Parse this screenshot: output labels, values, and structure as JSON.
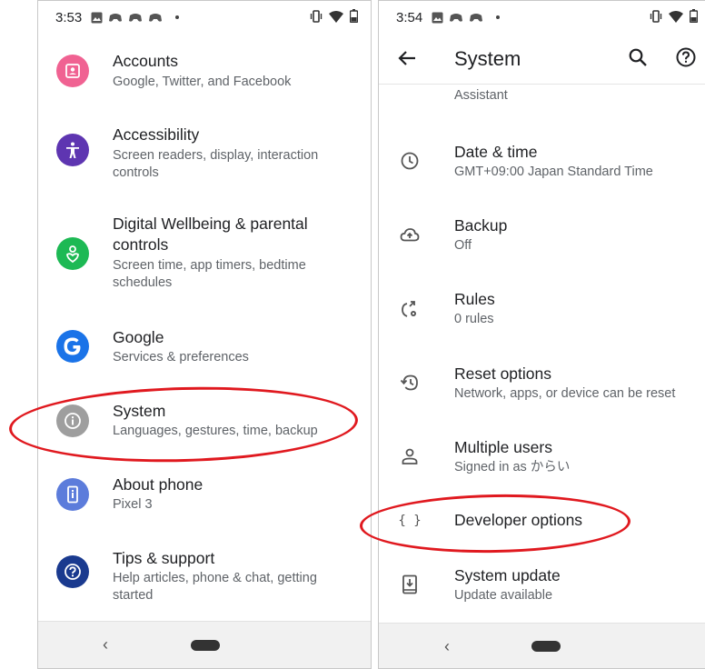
{
  "left_screen": {
    "status": {
      "time": "3:53"
    },
    "items": [
      {
        "title": "Accounts",
        "subtitle": "Google, Twitter, and Facebook",
        "icon": "accounts-icon",
        "color": "#f06292"
      },
      {
        "title": "Accessibility",
        "subtitle": "Screen readers, display, interaction controls",
        "icon": "accessibility-icon",
        "color": "#5e35b1"
      },
      {
        "title": "Digital Wellbeing & parental controls",
        "subtitle": "Screen time, app timers, bedtime schedules",
        "icon": "wellbeing-icon",
        "color": "#1db954"
      },
      {
        "title": "Google",
        "subtitle": "Services & preferences",
        "icon": "google-icon",
        "color": "#1a73e8"
      },
      {
        "title": "System",
        "subtitle": "Languages, gestures, time, backup",
        "icon": "info-icon",
        "color": "#9e9e9e"
      },
      {
        "title": "About phone",
        "subtitle": "Pixel 3",
        "icon": "phone-info-icon",
        "color": "#5c7cdb"
      },
      {
        "title": "Tips & support",
        "subtitle": "Help articles, phone & chat, getting started",
        "icon": "help-icon",
        "color": "#1a3a8f"
      }
    ],
    "nav": {
      "back": "‹"
    }
  },
  "right_screen": {
    "status": {
      "time": "3:54"
    },
    "app_bar": {
      "title": "System"
    },
    "partial_item": {
      "subtitle": "Assistant"
    },
    "items": [
      {
        "title": "Date & time",
        "subtitle": "GMT+09:00 Japan Standard Time",
        "icon": "clock-icon"
      },
      {
        "title": "Backup",
        "subtitle": "Off",
        "icon": "cloud-upload-icon"
      },
      {
        "title": "Rules",
        "subtitle": "0 rules",
        "icon": "rules-icon"
      },
      {
        "title": "Reset options",
        "subtitle": "Network, apps, or device can be reset",
        "icon": "history-icon"
      },
      {
        "title": "Multiple users",
        "subtitle": "Signed in as からい",
        "icon": "person-icon"
      },
      {
        "title": "Developer options",
        "subtitle": "",
        "icon": "code-braces-icon",
        "glyph": "{ }"
      },
      {
        "title": "System update",
        "subtitle": "Update available",
        "icon": "system-update-icon"
      }
    ],
    "nav": {
      "back": "‹"
    }
  },
  "highlight_color": "#e0191f"
}
